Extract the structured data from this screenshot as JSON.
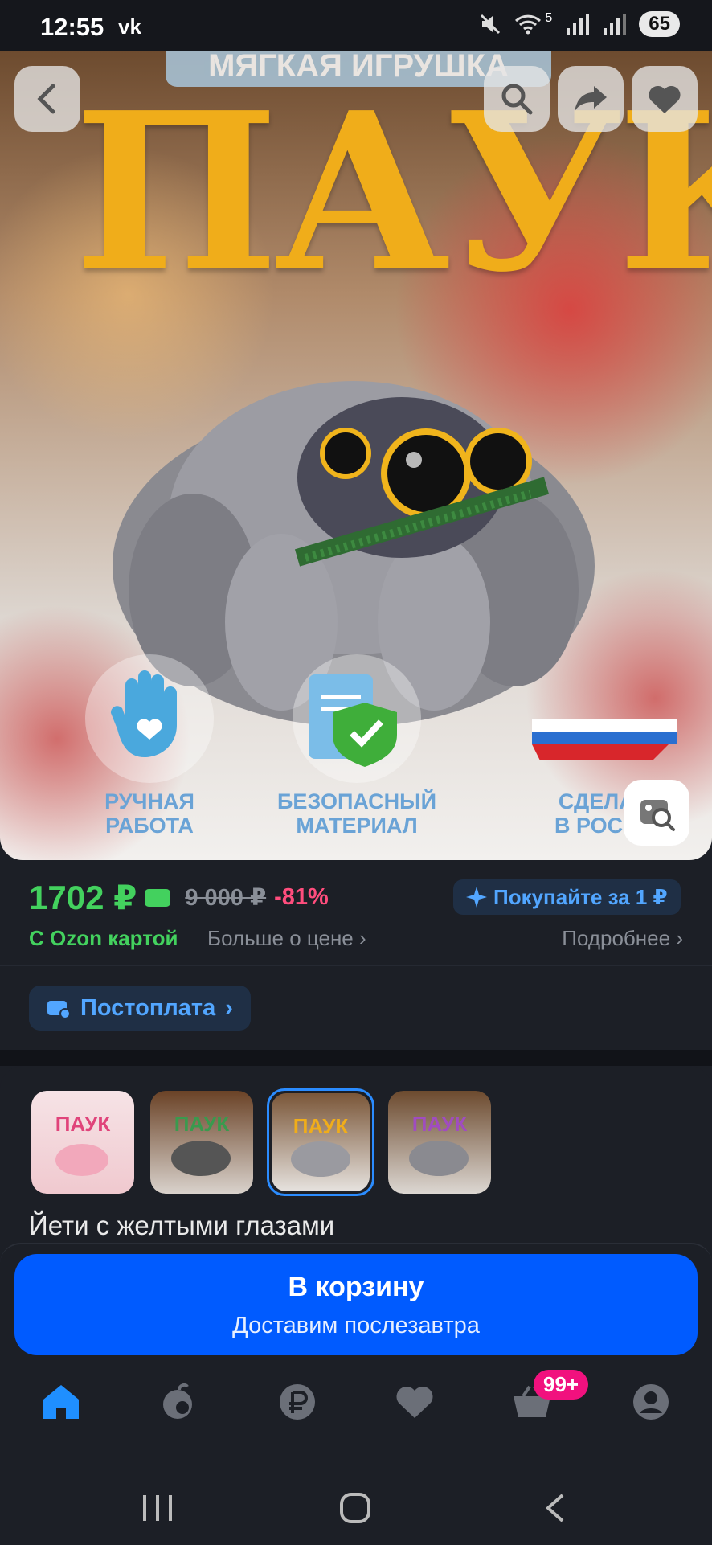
{
  "status_bar": {
    "time": "12:55",
    "app_icon": "vk",
    "signal_label": "5",
    "battery": "65"
  },
  "hero": {
    "banner_text": "МЯГКАЯ ИГРУШКА",
    "title": "ПАУК",
    "badges": [
      {
        "line1": "РУЧНАЯ",
        "line2": "РАБОТА",
        "icon": "hand-heart-icon"
      },
      {
        "line1": "БЕЗОПАСНЫЙ",
        "line2": "МАТЕРИАЛ",
        "icon": "document-shield-icon"
      },
      {
        "line1": "СДЕЛАН",
        "line2": "В РОССИ",
        "icon": "russia-map-icon"
      }
    ]
  },
  "price": {
    "current": "1702 ₽",
    "old": "9 000 ₽",
    "discount": "-81%",
    "promo": "Покупайте за 1 ₽",
    "ozon_card_label": "С Ozon картой",
    "more_price_label": "Больше о цене",
    "details_label": "Подробнее"
  },
  "postpay_label": "Постоплата",
  "variants": {
    "thumbs": [
      "ПАУК",
      "ПАУК",
      "ПАУК",
      "ПАУК"
    ],
    "selected_index": 2,
    "selected_name": "Йети с желтыми глазами"
  },
  "cart": {
    "title": "В корзину",
    "subtitle": "Доставим послезавтра"
  },
  "tabbar": {
    "items": [
      "home-icon",
      "fresh-icon",
      "ruble-icon",
      "favorites-icon",
      "cart-icon",
      "profile-icon"
    ],
    "cart_badge": "99+",
    "active": "home-icon"
  },
  "colors": {
    "accent": "#005bff",
    "price_green": "#43d15e",
    "discount_pink": "#ff4d7d",
    "title_gold": "#f0ad1a"
  }
}
